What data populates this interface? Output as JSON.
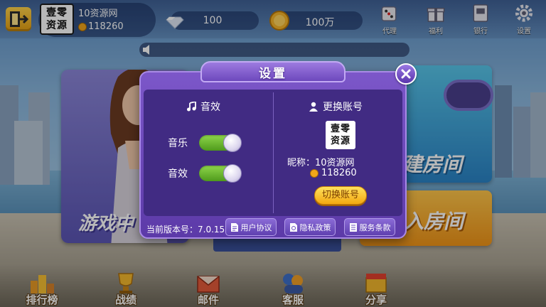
{
  "header": {
    "logo_line1": "壹零",
    "logo_line2": "资源",
    "nickname": "10资源网",
    "user_id": "118260",
    "diamonds": "100",
    "gold": "100万",
    "actions": [
      {
        "label": "代理",
        "icon": "dice-icon"
      },
      {
        "label": "福利",
        "icon": "gift-icon"
      },
      {
        "label": "银行",
        "icon": "bank-icon"
      },
      {
        "label": "设置",
        "icon": "gear-icon"
      }
    ]
  },
  "modes": {
    "left_label": "游戏中",
    "create_label": "建房间",
    "join_label": "入房间"
  },
  "bottom_nav": [
    {
      "label": "排行榜",
      "icon": "trophy-icon"
    },
    {
      "label": "战绩",
      "icon": "award-icon"
    },
    {
      "label": "邮件",
      "icon": "mail-icon"
    },
    {
      "label": "客服",
      "icon": "support-icon"
    },
    {
      "label": "分享",
      "icon": "share-icon"
    }
  ],
  "settings": {
    "title": "设置",
    "sound_section": "音效",
    "music_label": "音乐",
    "music_on": true,
    "effects_label": "音效",
    "effects_on": true,
    "account_section": "更换账号",
    "account_logo_line1": "壹零",
    "account_logo_line2": "资源",
    "nickname_line": "昵称：10资源网",
    "id_value": "118260",
    "switch_button": "切换账号",
    "version": "当前版本号：7.0.15",
    "user_agreement": "用户协议",
    "privacy_policy": "隐私政策",
    "service_terms": "服务条款"
  },
  "colors": {
    "dialog": "#6a48bb",
    "toggle_on": "#6cbf32",
    "switch_button": "#f7c22d"
  }
}
